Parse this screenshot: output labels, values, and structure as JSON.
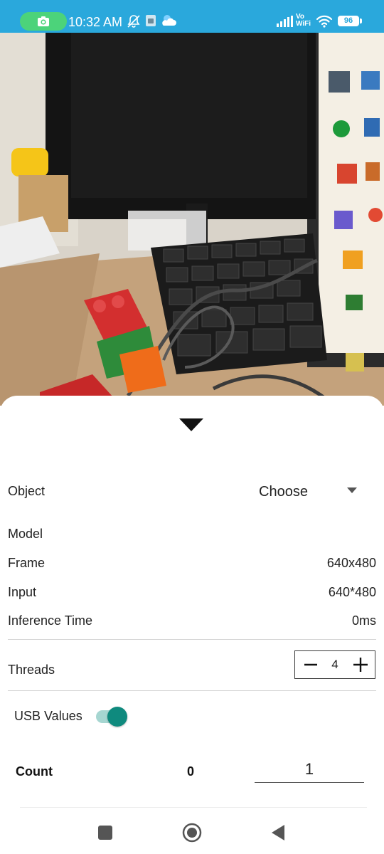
{
  "status_bar": {
    "time": "10:32 AM",
    "network_label_line1": "Vo",
    "network_label_line2": "WiFi",
    "battery": "96",
    "icons": [
      "camera-icon",
      "mute-notification-icon",
      "sim-icon",
      "weather-icon",
      "signal-icon",
      "wifi-icon",
      "battery-icon"
    ]
  },
  "preview": {
    "description_icon": "camera-preview"
  },
  "sheet": {
    "toggle_icon": "caret-down-icon",
    "object": {
      "label": "Object",
      "value": "Choose"
    },
    "model": {
      "label": "Model",
      "value": ""
    },
    "frame": {
      "label": "Frame",
      "value": "640x480"
    },
    "input": {
      "label": "Input",
      "value": "640*480"
    },
    "inference": {
      "label": "Inference Time",
      "value": "0ms"
    },
    "threads": {
      "label": "Threads",
      "value": "4"
    },
    "usb": {
      "label": "USB Values",
      "enabled": true
    },
    "count": {
      "label": "Count",
      "value": "0",
      "input_value": "1"
    }
  },
  "navbar": {
    "icons": [
      "recents-square-icon",
      "home-circle-icon",
      "back-triangle-icon"
    ]
  },
  "colors": {
    "status_bar": "#2aa8dc",
    "camera_pill": "#4cd37a",
    "switch_thumb": "#0f8a7e",
    "switch_track": "#a6d6d1"
  }
}
